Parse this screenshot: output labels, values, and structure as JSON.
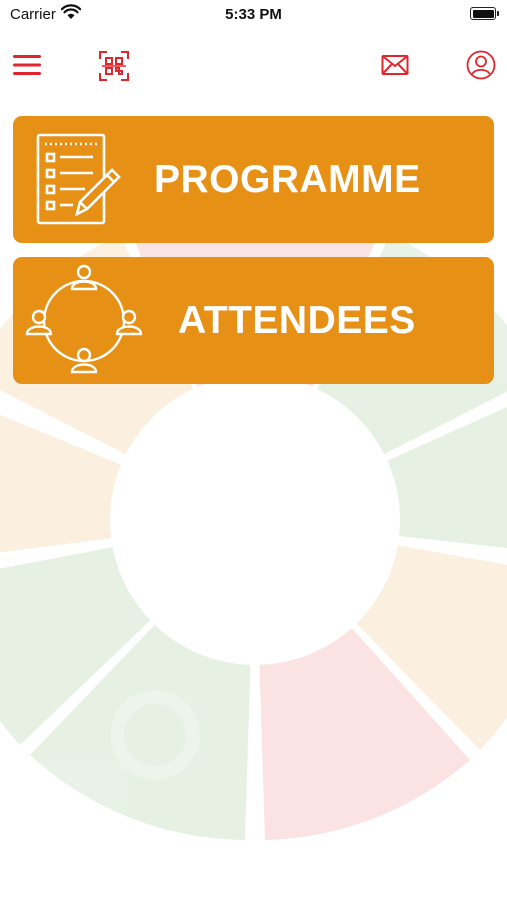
{
  "status_bar": {
    "carrier": "Carrier",
    "time": "5:33 PM"
  },
  "toolbar": {
    "menu_icon": "menu-icon",
    "scan_icon": "qr-scan-icon",
    "mail_icon": "mail-icon",
    "profile_icon": "user-profile-icon"
  },
  "tiles": [
    {
      "label": "PROGRAMME",
      "icon": "checklist-icon"
    },
    {
      "label": "ATTENDEES",
      "icon": "people-network-icon"
    }
  ],
  "colors": {
    "accent_red": "#e1262d",
    "tile_orange": "#e79016"
  }
}
